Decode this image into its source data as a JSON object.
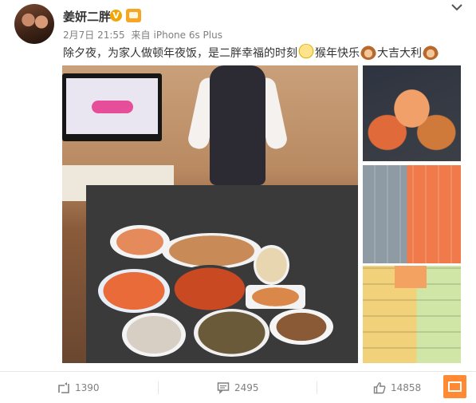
{
  "post": {
    "author": {
      "name": "姜妍二胖",
      "verified_badge": "V"
    },
    "meta": {
      "date": "2月7日 21:55",
      "source_prefix": "来自",
      "source": "iPhone 6s Plus"
    },
    "text": {
      "part1": "除夕夜，为家人做顿年夜饭，是二胖幸福的时刻",
      "part2": "猴年快乐",
      "part3": "大吉大利"
    },
    "emojis": [
      "smile-sad-emoji",
      "monkey-emoji",
      "monkey-emoji"
    ],
    "images": [
      "dinner-table-photo",
      "seafood-platter-photo",
      "shrimp-tray-photo",
      "dumplings-tray-photo"
    ],
    "tv_logo_text": ""
  },
  "actions": {
    "repost_count": "1390",
    "comment_count": "2495",
    "like_count": "14858"
  },
  "colors": {
    "accent_orange": "#ff8a33",
    "badge_yellow": "#f0a500",
    "muted_text": "#808080"
  }
}
